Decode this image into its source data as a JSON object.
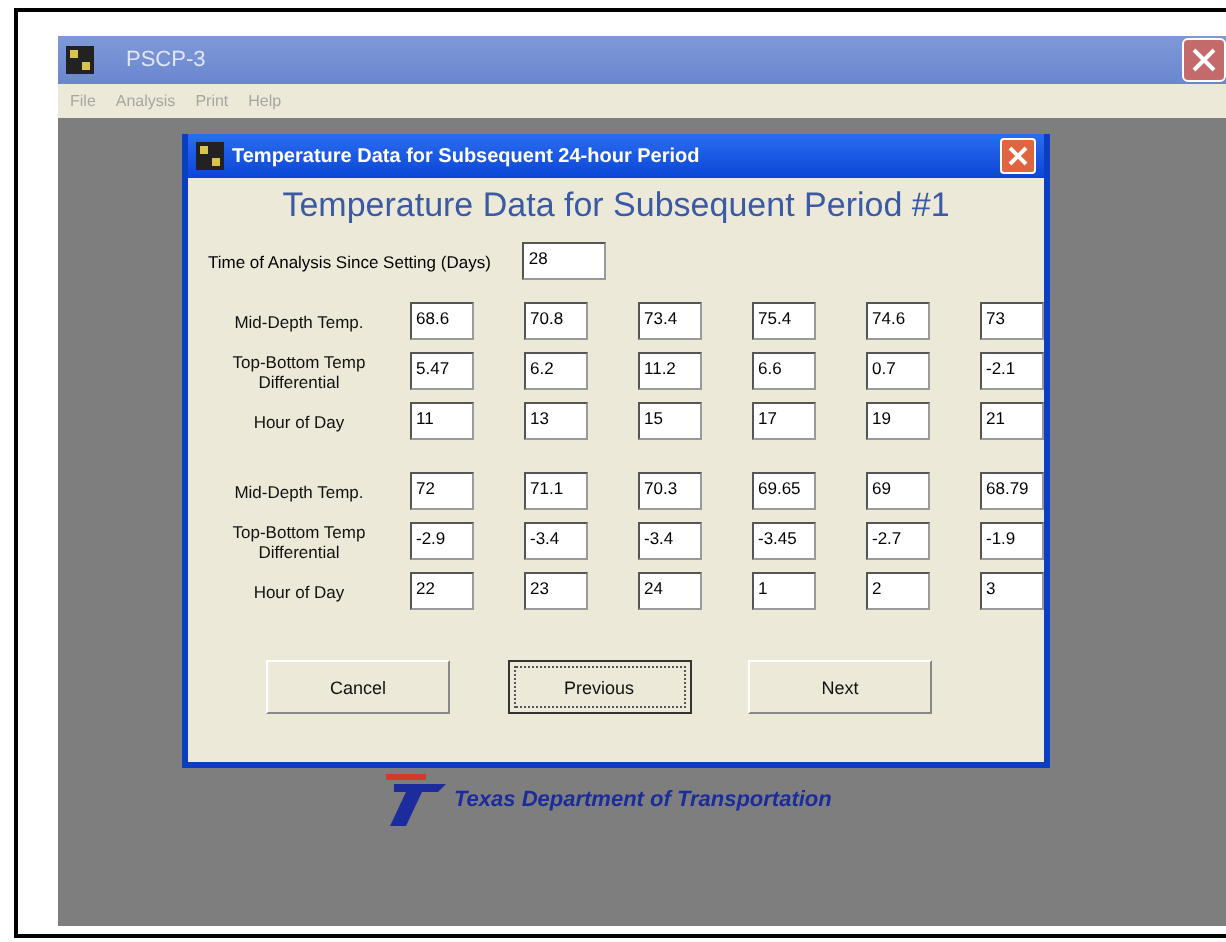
{
  "app_window": {
    "title": "PSCP-3"
  },
  "menu": [
    "File",
    "Analysis",
    "Print",
    "Help"
  ],
  "dialog": {
    "title": "Temperature Data for Subsequent 24-hour Period",
    "heading": "Temperature Data for Subsequent Period #1",
    "time_field": {
      "label": "Time of Analysis Since Setting (Days)",
      "value": "28"
    },
    "groups": [
      [
        {
          "label": "Mid-Depth Temp.",
          "values": [
            "68.6",
            "70.8",
            "73.4",
            "75.4",
            "74.6",
            "73"
          ]
        },
        {
          "label": "Top-Bottom Temp Differential",
          "values": [
            "5.47",
            "6.2",
            "11.2",
            "6.6",
            "0.7",
            "-2.1"
          ]
        },
        {
          "label": "Hour of Day",
          "values": [
            "11",
            "13",
            "15",
            "17",
            "19",
            "21"
          ]
        }
      ],
      [
        {
          "label": "Mid-Depth Temp.",
          "values": [
            "72",
            "71.1",
            "70.3",
            "69.65",
            "69",
            "68.79"
          ]
        },
        {
          "label": "Top-Bottom Temp Differential",
          "values": [
            "-2.9",
            "-3.4",
            "-3.4",
            "-3.45",
            "-2.7",
            "-1.9"
          ]
        },
        {
          "label": "Hour of Day",
          "values": [
            "22",
            "23",
            "24",
            "1",
            "2",
            "3"
          ]
        }
      ]
    ],
    "buttons": [
      {
        "label": "Cancel",
        "focused": false
      },
      {
        "label": "Previous",
        "focused": true
      },
      {
        "label": "Next",
        "focused": false
      }
    ]
  },
  "footer": {
    "organization": "Texas Department of Transportation"
  }
}
